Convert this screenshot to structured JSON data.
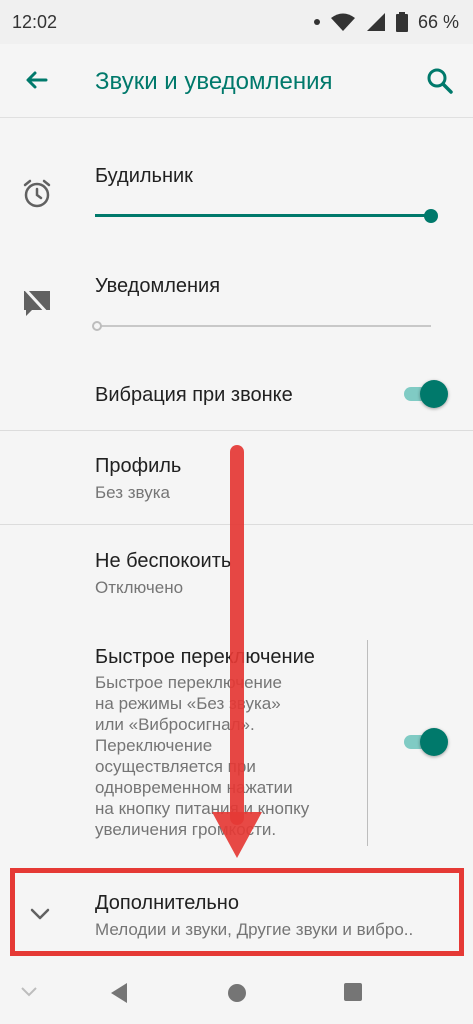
{
  "status_bar": {
    "time": "12:02",
    "battery": "66 %"
  },
  "app_bar": {
    "title": "Звуки и уведомления"
  },
  "alarm": {
    "label": "Будильник",
    "level": 1.0
  },
  "notifications": {
    "label": "Уведомления",
    "level": 0.0
  },
  "vibration": {
    "label": "Вибрация при звонке",
    "enabled": true
  },
  "profile": {
    "title": "Профиль",
    "value": "Без звука"
  },
  "dnd": {
    "title": "Не беспокоить",
    "value": "Отключено"
  },
  "quick_switch": {
    "title": "Быстрое переключение",
    "description_lines": [
      "Быстрое переключение",
      "на режимы «Без звука»",
      "или «Вибросигнал».",
      "Переключение",
      "осуществляется при",
      "одновременном нажатии",
      "на кнопку питания и кнопку",
      "увеличения громкости."
    ],
    "enabled": true
  },
  "advanced": {
    "title": "Дополнительно",
    "summary": "Мелодии и звуки, Другие звуки и вибро.."
  },
  "colors": {
    "accent": "#00796b",
    "annotation": "#e53935"
  }
}
